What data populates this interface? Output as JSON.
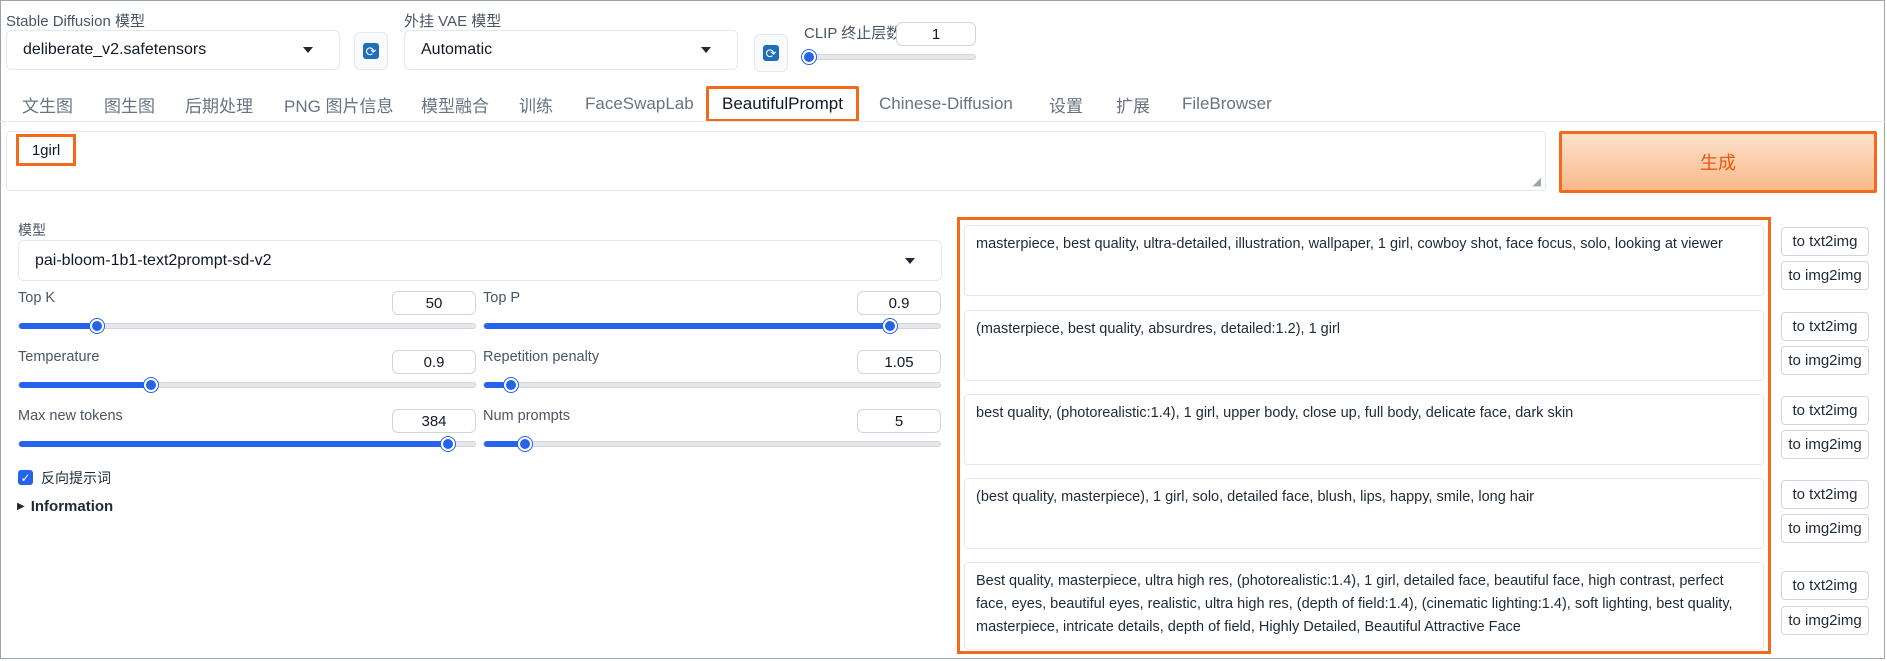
{
  "top": {
    "sd_model": {
      "label": "Stable Diffusion 模型",
      "value": "deliberate_v2.safetensors"
    },
    "vae_model": {
      "label": "外挂 VAE 模型",
      "value": "Automatic"
    },
    "clip": {
      "label": "CLIP 终止层数",
      "value": "1",
      "level": 0.0
    }
  },
  "tabs": [
    "文生图",
    "图生图",
    "后期处理",
    "PNG 图片信息",
    "模型融合",
    "训练",
    "FaceSwapLab",
    "BeautifulPrompt",
    "Chinese-Diffusion",
    "设置",
    "扩展",
    "FileBrowser"
  ],
  "active_tab": "BeautifulPrompt",
  "prompt_input": {
    "value": "1girl"
  },
  "generate_label": "生成",
  "model": {
    "label": "模型",
    "value": "pai-bloom-1b1-text2prompt-sd-v2"
  },
  "params": {
    "top_k": {
      "label": "Top K",
      "value": "50",
      "level": 0.17
    },
    "top_p": {
      "label": "Top P",
      "value": "0.9",
      "level": 0.89
    },
    "temperature": {
      "label": "Temperature",
      "value": "0.9",
      "level": 0.29
    },
    "repetition_penalty": {
      "label": "Repetition penalty",
      "value": "1.05",
      "level": 0.06
    },
    "max_new_tokens": {
      "label": "Max new tokens",
      "value": "384",
      "level": 0.94
    },
    "num_prompts": {
      "label": "Num prompts",
      "value": "5",
      "level": 0.09
    }
  },
  "negative_prompt": {
    "label": "反向提示词",
    "checked": true
  },
  "information_label": "Information",
  "results": [
    "masterpiece, best quality, ultra-detailed, illustration, wallpaper, 1 girl, cowboy shot, face focus, solo, looking at viewer",
    "(masterpiece, best quality, absurdres, detailed:1.2), 1 girl",
    "best quality, (photorealistic:1.4), 1 girl, upper body, close up, full body, delicate face, dark skin",
    "(best quality, masterpiece), 1 girl, solo, detailed face, blush, lips, happy, smile, long hair",
    "Best quality, masterpiece, ultra high res, (photorealistic:1.4), 1 girl, detailed face, beautiful face, high contrast, perfect face, eyes, beautiful eyes, realistic, ultra high res, (depth of field:1.4), (cinematic lighting:1.4), soft lighting, best quality, masterpiece, intricate details, depth of field, Highly Detailed, Beautiful Attractive Face"
  ],
  "send_buttons": {
    "txt2img": "to txt2img",
    "img2img": "to img2img"
  },
  "colors": {
    "accent": "#2563eb",
    "highlight": "#f26b1d",
    "generate": "#ea580c"
  }
}
